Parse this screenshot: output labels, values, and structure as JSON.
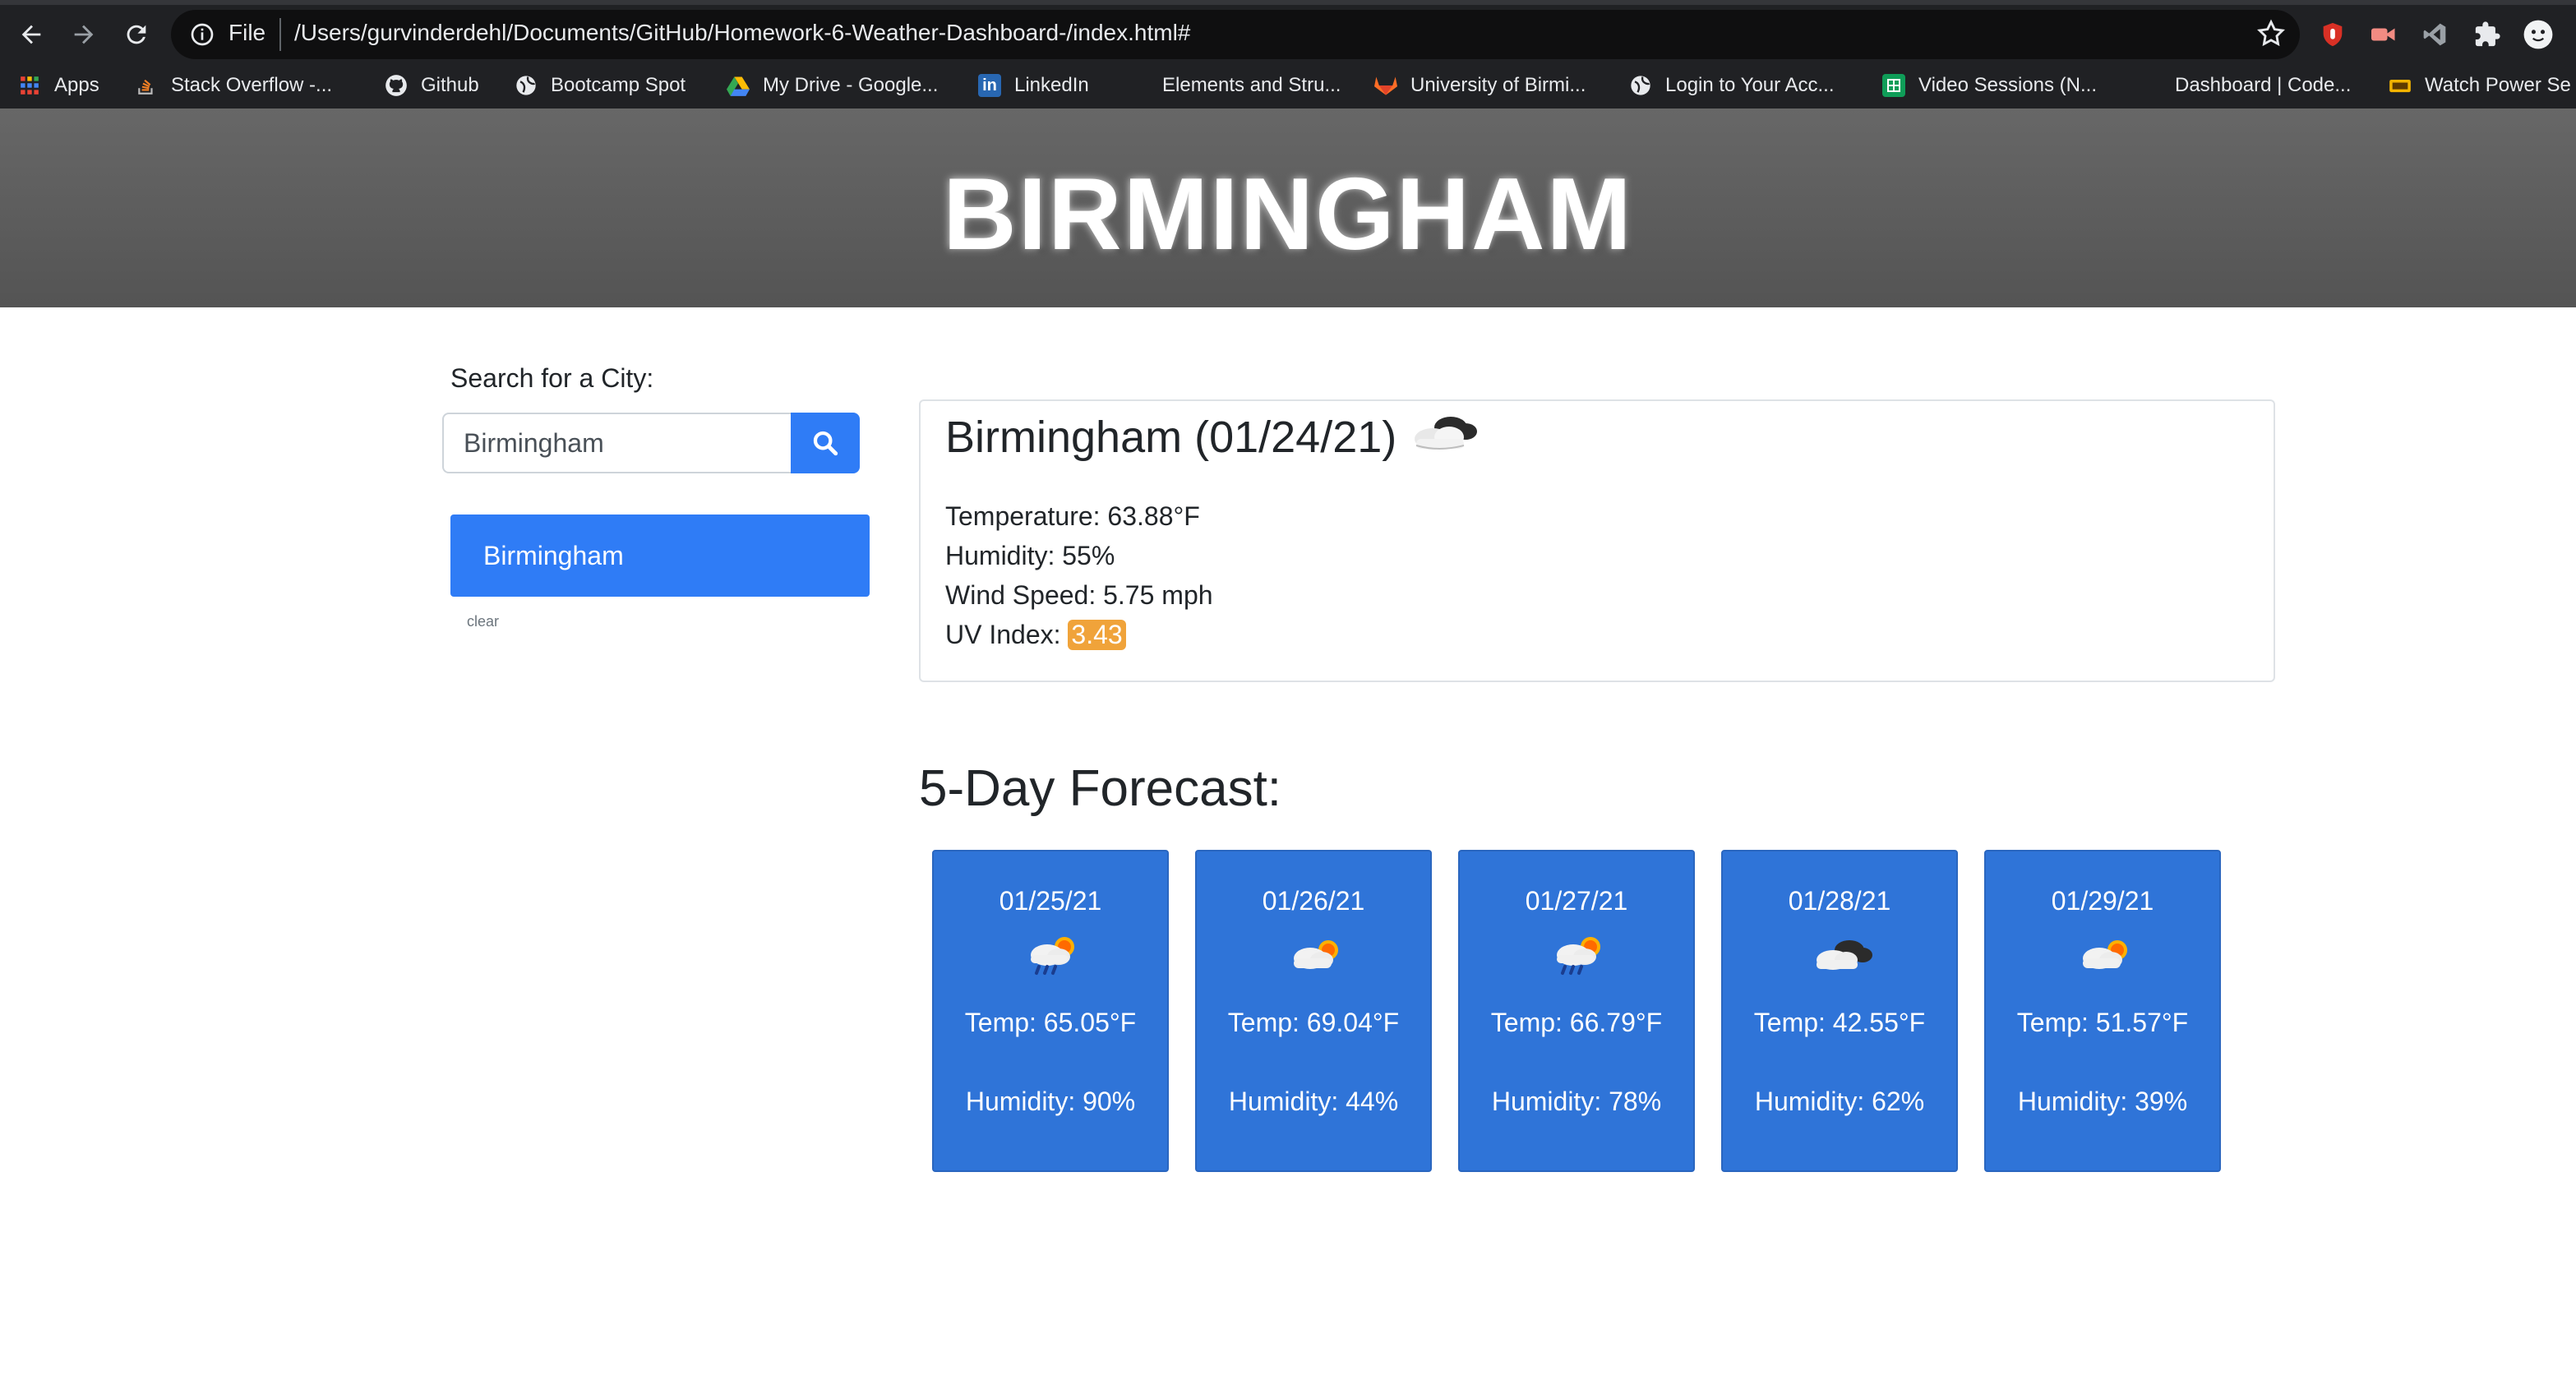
{
  "browser": {
    "scheme": "File",
    "url": "/Users/gurvinderdehl/Documents/GitHub/Homework-6-Weather-Dashboard-/index.html#",
    "bookmarks": [
      {
        "label": "Apps",
        "icon": "apps-grid-icon"
      },
      {
        "label": "Stack Overflow -...",
        "icon": "stackoverflow-icon"
      },
      {
        "label": "Github",
        "icon": "github-icon"
      },
      {
        "label": "Bootcamp Spot",
        "icon": "globe-icon"
      },
      {
        "label": "My Drive - Google...",
        "icon": "google-drive-icon"
      },
      {
        "label": "LinkedIn",
        "icon": "linkedin-icon"
      },
      {
        "label": "Elements and Stru...",
        "icon": "page-icon"
      },
      {
        "label": "University of Birmi...",
        "icon": "gitlab-icon"
      },
      {
        "label": "Login to Your Acc...",
        "icon": "globe-icon"
      },
      {
        "label": "Video Sessions (N...",
        "icon": "sheets-icon"
      },
      {
        "label": "Dashboard | Code...",
        "icon": "page-icon"
      },
      {
        "label": "Watch Power Se",
        "icon": "tv-icon"
      }
    ]
  },
  "header": {
    "city": "BIRMINGHAM"
  },
  "search": {
    "label": "Search for a City:",
    "value": "Birmingham",
    "history": [
      "Birmingham"
    ],
    "clear_label": "clear"
  },
  "current": {
    "heading": "Birmingham (01/24/21)",
    "icon": "cloudy-icon",
    "temperature": "Temperature: 63.88°F",
    "humidity": "Humidity: 55%",
    "wind": "Wind Speed: 5.75 mph",
    "uv_label": "UV Index:",
    "uv_value": "3.43",
    "uv_color": "#f0a33a"
  },
  "forecast": {
    "title": "5-Day Forecast:",
    "days": [
      {
        "date": "01/25/21",
        "icon": "rain-sun-icon",
        "temp": "Temp: 65.05°F",
        "humidity": "Humidity: 90%"
      },
      {
        "date": "01/26/21",
        "icon": "partly-cloudy-icon",
        "temp": "Temp: 69.04°F",
        "humidity": "Humidity: 44%"
      },
      {
        "date": "01/27/21",
        "icon": "rain-sun-icon",
        "temp": "Temp: 66.79°F",
        "humidity": "Humidity: 78%"
      },
      {
        "date": "01/28/21",
        "icon": "cloudy-icon",
        "temp": "Temp: 42.55°F",
        "humidity": "Humidity: 62%"
      },
      {
        "date": "01/29/21",
        "icon": "partly-cloudy-icon",
        "temp": "Temp: 51.57°F",
        "humidity": "Humidity: 39%"
      }
    ]
  },
  "colors": {
    "accent": "#2f7cf6",
    "forecast_card": "#2f74d8",
    "header_bg": "#5e5e5e"
  }
}
